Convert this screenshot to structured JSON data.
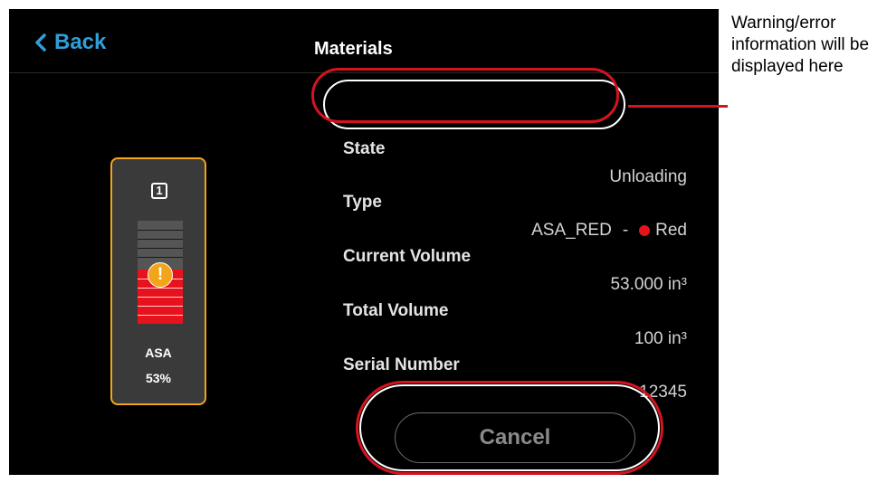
{
  "header": {
    "back_label": "Back",
    "title": "Materials"
  },
  "material_card": {
    "slot": "1",
    "name": "ASA",
    "percent_label": "53%",
    "fill_fraction": 0.53,
    "accent_color": "#f2a51a",
    "fill_color": "#e8121c"
  },
  "details": {
    "state_label": "State",
    "state_value": "Unloading",
    "type_label": "Type",
    "type_value": "ASA_RED",
    "type_separator": "-",
    "type_color_name": "Red",
    "current_volume_label": "Current Volume",
    "current_volume_value": "53.000 in³",
    "total_volume_label": "Total Volume",
    "total_volume_value": "100 in³",
    "serial_label": "Serial Number",
    "serial_value": "12345"
  },
  "actions": {
    "cancel_label": "Cancel"
  },
  "annotation": {
    "text": "Warning/error information will be displayed here"
  },
  "icons": {
    "back": "chevron-left-icon",
    "warning": "warning-icon"
  }
}
